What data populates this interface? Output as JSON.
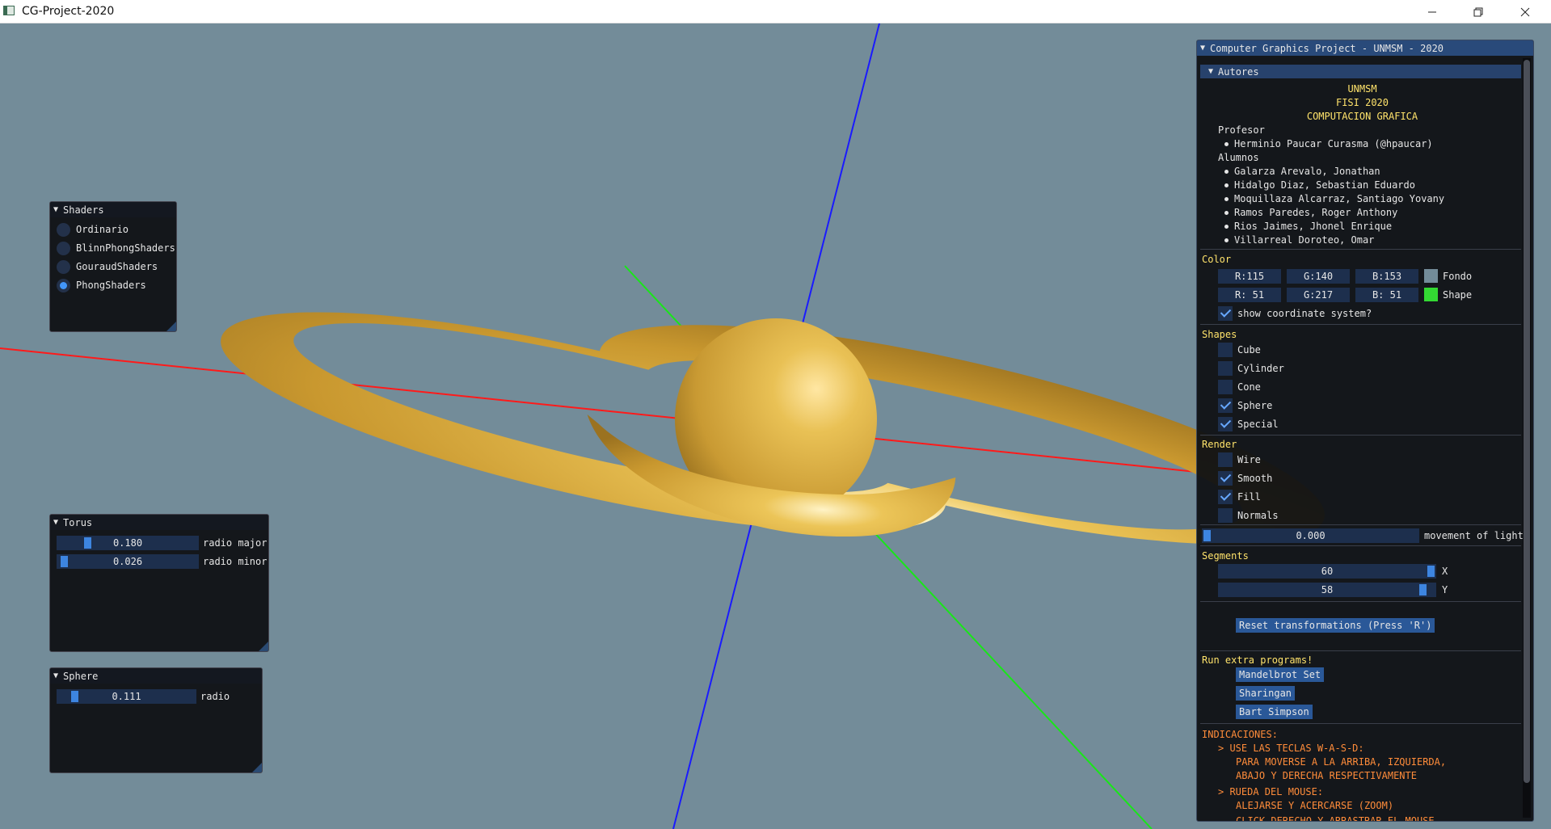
{
  "window": {
    "title": "CG-Project-2020"
  },
  "colors": {
    "background": "#738c99",
    "shape": "#33d933",
    "saturn": "#e1b54c"
  },
  "shaders_panel": {
    "title": "Shaders",
    "options": [
      "Ordinario",
      "BlinnPhongShaders",
      "GouraudShaders",
      "PhongShaders"
    ],
    "selected": "PhongShaders"
  },
  "torus_panel": {
    "title": "Torus",
    "sliders": [
      {
        "value": "0.180",
        "label": "radio major",
        "fraction": 0.18
      },
      {
        "value": "0.026",
        "label": "radio minor",
        "fraction": 0.026
      }
    ]
  },
  "sphere_panel": {
    "title": "Sphere",
    "slider": {
      "value": "0.111",
      "label": "radio",
      "fraction": 0.111
    }
  },
  "main_panel": {
    "title": "Computer Graphics Project - UNMSM - 2020",
    "autores": {
      "header": "Autores",
      "centered": [
        "UNMSM",
        "FISI 2020",
        "COMPUTACION GRAFICA"
      ],
      "profesor_label": "Profesor",
      "profesor": [
        "Herminio Paucar Curasma (@hpaucar)"
      ],
      "alumnos_label": "Alumnos",
      "alumnos": [
        "Galarza Arevalo, Jonathan",
        "Hidalgo Diaz, Sebastian Eduardo",
        "Moquillaza Alcarraz, Santiago Yovany",
        "Ramos Paredes, Roger Anthony",
        "Rios Jaimes, Jhonel Enrique",
        "Villarreal Doroteo, Omar"
      ]
    },
    "color": {
      "header": "Color",
      "fondo": {
        "r": "R:115",
        "g": "G:140",
        "b": "B:153",
        "label": "Fondo"
      },
      "shape": {
        "r": "R: 51",
        "g": "G:217",
        "b": "B: 51",
        "label": "Shape"
      },
      "coord_label": "show coordinate system?",
      "coord_checked": true
    },
    "shapes": {
      "header": "Shapes",
      "items": [
        {
          "label": "Cube",
          "checked": false
        },
        {
          "label": "Cylinder",
          "checked": false
        },
        {
          "label": "Cone",
          "checked": false
        },
        {
          "label": "Sphere",
          "checked": true
        },
        {
          "label": "Special",
          "checked": true
        }
      ]
    },
    "render": {
      "header": "Render",
      "items": [
        {
          "label": "Wire",
          "checked": false
        },
        {
          "label": "Smooth",
          "checked": true
        },
        {
          "label": "Fill",
          "checked": true
        },
        {
          "label": "Normals",
          "checked": false
        }
      ],
      "light_value": "0.000",
      "light_fraction": 0,
      "light_label": "movement of light"
    },
    "segments": {
      "header": "Segments",
      "x": {
        "value": "60",
        "label": "X",
        "fraction": 0.97
      },
      "y": {
        "value": "58",
        "label": "Y",
        "fraction": 0.93
      }
    },
    "reset_button": "Reset transformations (Press 'R')",
    "extra": {
      "header": "Run extra programs!",
      "buttons": [
        "Mandelbrot Set",
        "Sharingan",
        "Bart Simpson"
      ]
    },
    "indicaciones": {
      "header": "INDICACIONES:",
      "lines": [
        "> USE LAS TECLAS W-A-S-D:",
        "PARA MOVERSE A LA ARRIBA, IZQUIERDA,",
        "ABAJO Y DERECHA RESPECTIVAMENTE",
        "> RUEDA DEL MOUSE:",
        "ALEJARSE Y ACERCARSE (ZOOM)",
        "CLICK DERECHO Y ARRASTRAR EL MOUSE"
      ]
    }
  }
}
